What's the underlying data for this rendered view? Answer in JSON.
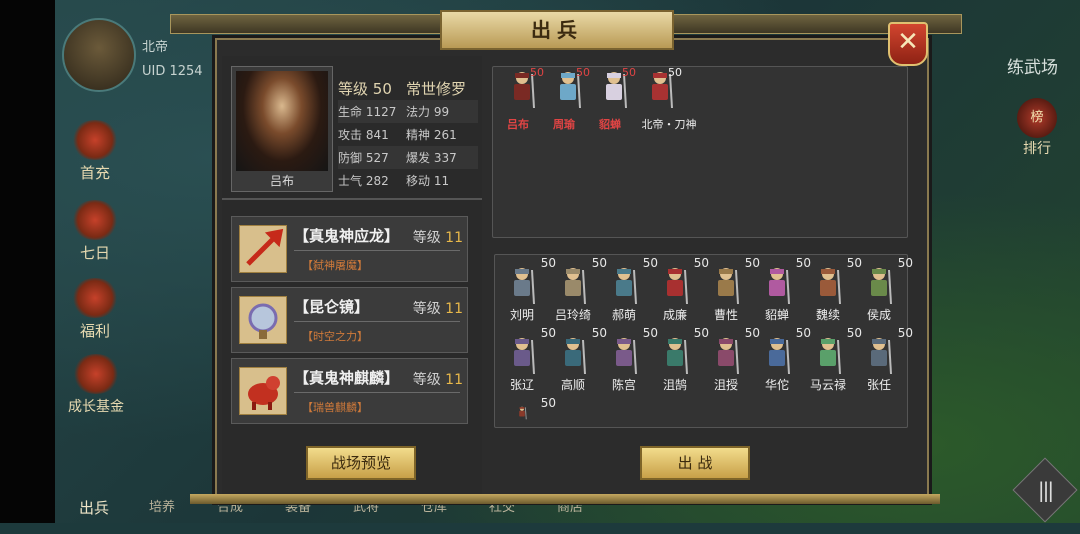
{
  "hud": {
    "server": "北帝",
    "uid": "UID 1254",
    "area_label": "练武场",
    "rank_label": "排行",
    "rank_icon_text": "榜"
  },
  "side_menu": [
    "首充",
    "七日",
    "福利",
    "成长基金"
  ],
  "bottom_nav": [
    "出兵",
    "培养",
    "合成",
    "装备",
    "武将",
    "仓库",
    "社交",
    "商店"
  ],
  "dialog": {
    "title": "出兵",
    "close": "✕"
  },
  "hero": {
    "name": "吕布",
    "level_label": "等级",
    "level": "50",
    "title": "常世修罗",
    "stats": [
      [
        "生命",
        "1127",
        "法力",
        "99"
      ],
      [
        "攻击",
        "841",
        "精神",
        "261"
      ],
      [
        "防御",
        "527",
        "爆发",
        "337"
      ],
      [
        "士气",
        "282",
        "移动",
        "11"
      ]
    ]
  },
  "equipment": [
    {
      "name": "【真鬼神应龙】",
      "level_label": "等级",
      "level": "11",
      "sub": "【弑神屠魔】",
      "color": "#d6422a"
    },
    {
      "name": "【昆仑镜】",
      "level_label": "等级",
      "level": "11",
      "sub": "【时空之力】",
      "color": "#b7c6dc"
    },
    {
      "name": "【真鬼神麒麟】",
      "level_label": "等级",
      "level": "11",
      "sub": "【瑞兽麒麟】",
      "color": "#c23020"
    }
  ],
  "team": [
    {
      "name": "吕布",
      "level": "50",
      "color": "#7a2a24"
    },
    {
      "name": "周瑜",
      "level": "50",
      "color": "#6ea8c8"
    },
    {
      "name": "貂蝉",
      "level": "50",
      "color": "#d8d0e0"
    },
    {
      "name": "北帝・刀神",
      "level": "50",
      "color": "#a83232",
      "white": true
    }
  ],
  "roster": [
    {
      "name": "刘明",
      "level": "50",
      "color": "#6a7a8a"
    },
    {
      "name": "吕玲绮",
      "level": "50",
      "color": "#9a8a6a"
    },
    {
      "name": "郝萌",
      "level": "50",
      "color": "#4a7a8a"
    },
    {
      "name": "成廉",
      "level": "50",
      "color": "#a83030"
    },
    {
      "name": "曹性",
      "level": "50",
      "color": "#9a7a4a"
    },
    {
      "name": "貂蝉",
      "level": "50",
      "color": "#b05aa0"
    },
    {
      "name": "魏续",
      "level": "50",
      "color": "#9a5a3a"
    },
    {
      "name": "侯成",
      "level": "50",
      "color": "#6a8a4a"
    },
    {
      "name": "张辽",
      "level": "50",
      "color": "#6a5a8a"
    },
    {
      "name": "高顺",
      "level": "50",
      "color": "#3a6a7a"
    },
    {
      "name": "陈宫",
      "level": "50",
      "color": "#7a5a8a"
    },
    {
      "name": "沮鹄",
      "level": "50",
      "color": "#3a7a6a"
    },
    {
      "name": "沮授",
      "level": "50",
      "color": "#8a4a6a"
    },
    {
      "name": "华佗",
      "level": "50",
      "color": "#4a6a9a"
    },
    {
      "name": "马云禄",
      "level": "50",
      "color": "#5aa06a"
    },
    {
      "name": "张任",
      "level": "50",
      "color": "#5a6a7a"
    },
    {
      "name": "",
      "level": "50",
      "color": "#8a3a2a"
    }
  ],
  "buttons": {
    "preview": "战场预览",
    "fight": "出 战"
  }
}
